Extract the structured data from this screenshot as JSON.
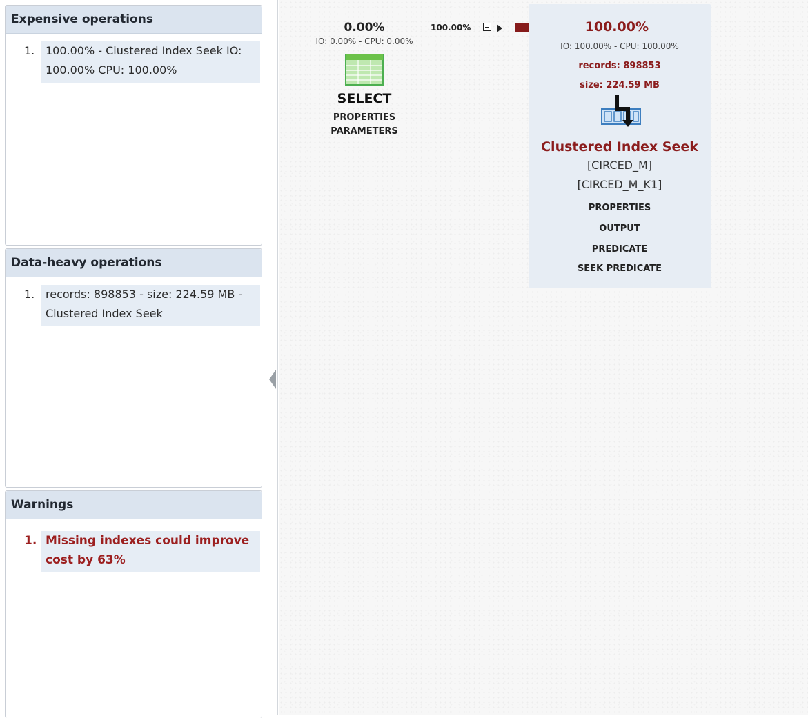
{
  "sidebar": {
    "expensive": {
      "title": "Expensive operations",
      "items": [
        {
          "num": "1.",
          "text": "100.00% - Clustered Index Seek IO: 100.00% CPU: 100.00%"
        }
      ]
    },
    "data_heavy": {
      "title": "Data-heavy operations",
      "items": [
        {
          "num": "1.",
          "text": "records: 898853 - size: 224.59 MB - Clustered Index Seek"
        }
      ]
    },
    "warnings": {
      "title": "Warnings",
      "items": [
        {
          "num": "1.",
          "text": "Missing indexes could improve cost by 63%"
        }
      ]
    }
  },
  "plan": {
    "select_node": {
      "cost_pct": "0.00%",
      "io_cpu": "IO: 0.00% - CPU: 0.00%",
      "op": "SELECT",
      "links": [
        "PROPERTIES",
        "PARAMETERS"
      ],
      "icon": "table-icon"
    },
    "connector": {
      "pct": "100.00%",
      "flow_fraction": 1.0,
      "bar_color": "#861b1b"
    },
    "seek_node": {
      "cost_pct": "100.00%",
      "io_cpu": "IO: 100.00% - CPU: 100.00%",
      "records": "records: 898853",
      "size": "size: 224.59 MB",
      "op": "Clustered Index Seek",
      "object_table": "[CIRCED_M]",
      "object_index": "[CIRCED_M_K1]",
      "links": [
        "PROPERTIES",
        "OUTPUT",
        "PREDICATE",
        "SEEK PREDICATE"
      ],
      "icon": "clustered-index-seek-icon",
      "accent": "#8b1c1c"
    }
  },
  "colors": {
    "header_bg": "#dbe4ef",
    "item_bg": "#e6edf5",
    "warning_text": "#9c1f1f",
    "node_bg": "#e7edf4"
  }
}
